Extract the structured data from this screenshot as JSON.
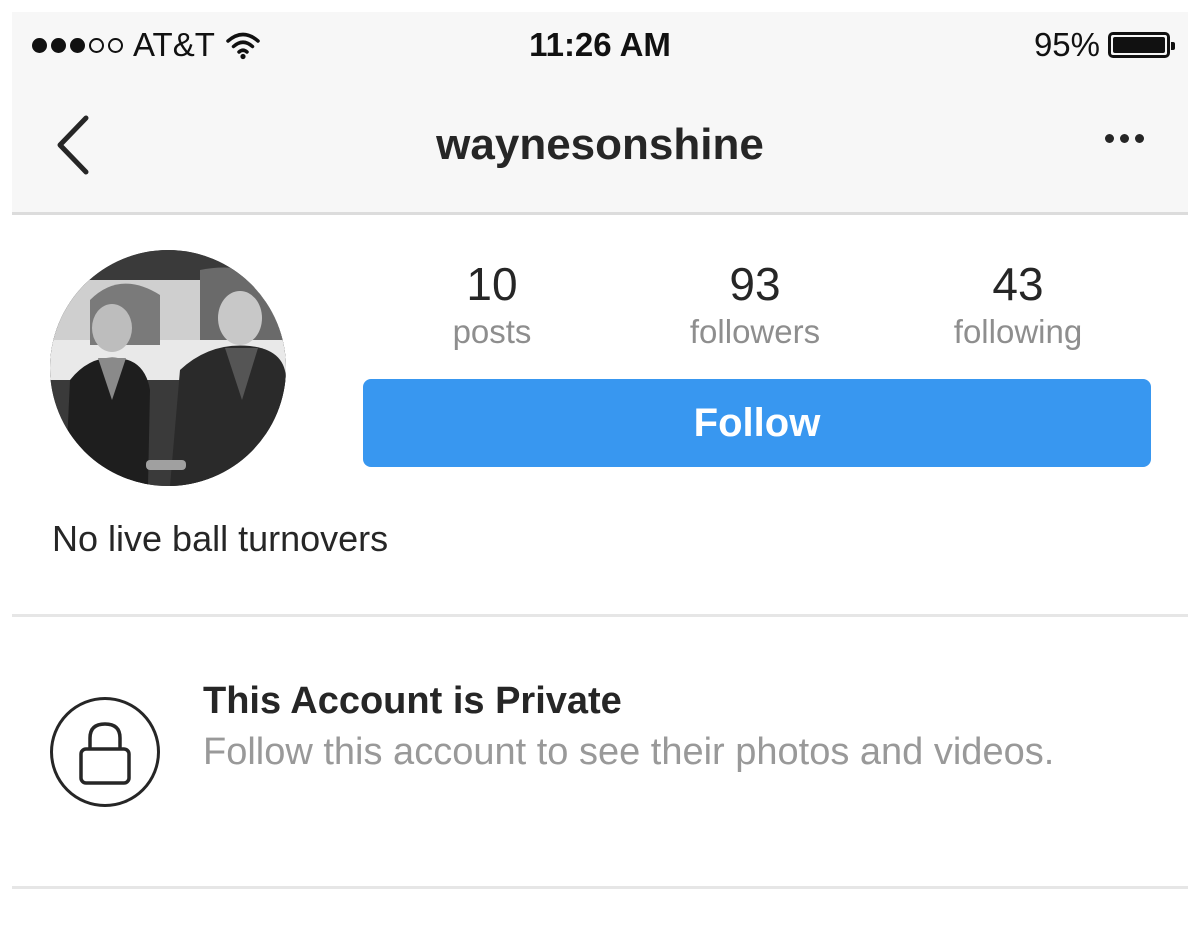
{
  "status_bar": {
    "carrier": "AT&T",
    "signal_strength": "3 of 5",
    "time": "11:26 AM",
    "battery_percent": "95%"
  },
  "nav": {
    "title": "waynesonshine",
    "back_icon": "chevron-left-icon",
    "more_icon": "more-dots-icon"
  },
  "profile": {
    "stats": [
      {
        "value": "10",
        "label": "posts"
      },
      {
        "value": "93",
        "label": "followers"
      },
      {
        "value": "43",
        "label": "following"
      }
    ],
    "follow_label": "Follow",
    "bio": "No live ball turnovers"
  },
  "private_notice": {
    "title": "This Account is Private",
    "text": "Follow this account to see their photos and videos.",
    "icon": "lock-icon"
  },
  "colors": {
    "follow_button": "#3897f0",
    "bar_background": "#f7f7f7",
    "secondary_text": "#8e8e8e"
  }
}
